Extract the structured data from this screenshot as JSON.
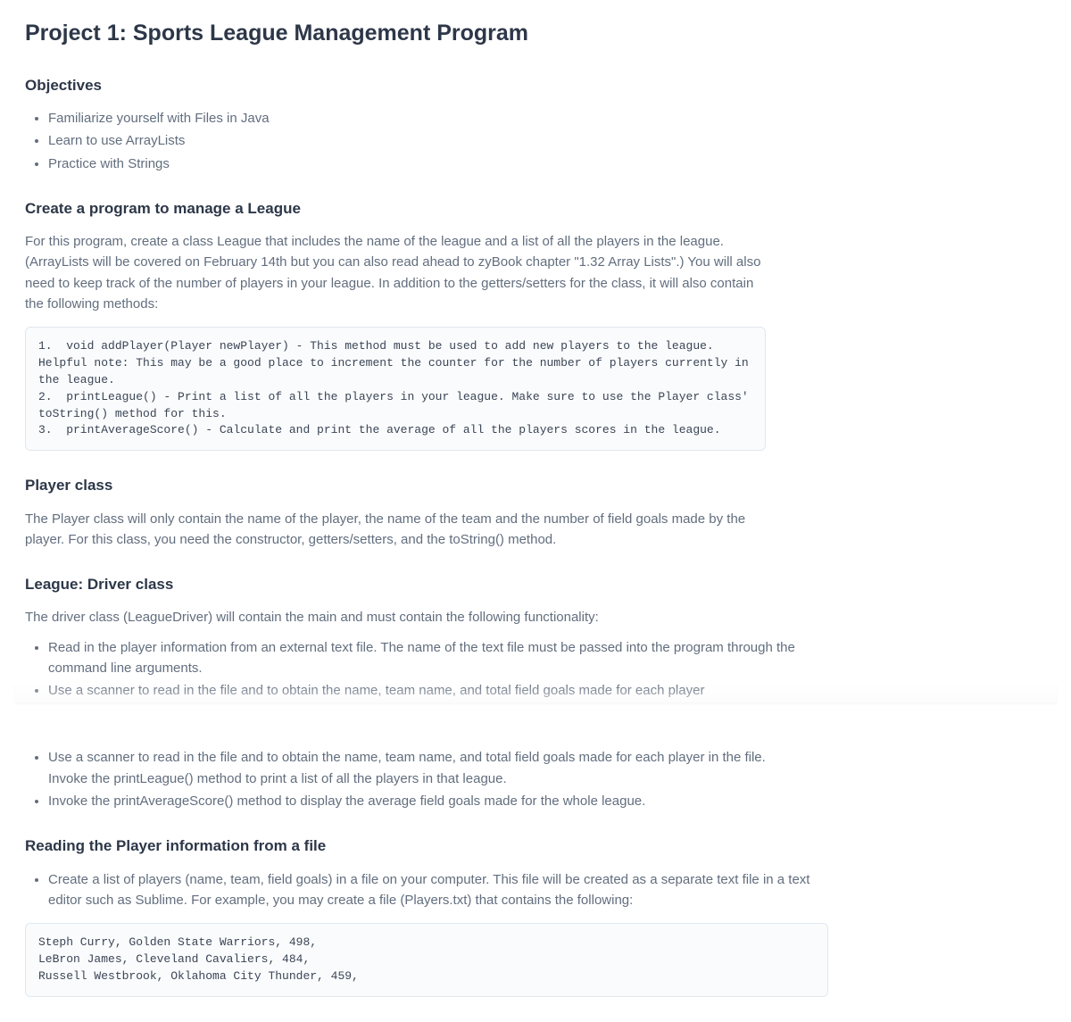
{
  "title": "Project 1: Sports League Management Program",
  "objectives": {
    "heading": "Objectives",
    "items": [
      "Familiarize yourself with Files in Java",
      "Learn to use ArrayLists",
      "Practice with Strings"
    ]
  },
  "create": {
    "heading": "Create a program to manage a League",
    "paragraph": "For this program, create a class League that includes the name of the league and a list of all the players in the league.  (ArrayLists will be covered on February 14th but you can also read ahead to zyBook chapter \"1.32 Array Lists\".)  You will also need to keep track of the number of players in your league. In addition to the getters/setters for the class, it will also contain the following methods:",
    "code": "1.  void addPlayer(Player newPlayer) - This method must be used to add new players to the league. Helpful note: This may be a good place to increment the counter for the number of players currently in the league.\n2.  printLeague() - Print a list of all the players in your league. Make sure to use the Player class' toString() method for this.\n3.  printAverageScore() - Calculate and print the average of all the players scores in the league."
  },
  "player": {
    "heading": "Player class",
    "paragraph": "The Player class will only contain the name of the player, the name of the team and the number of field goals made by the player. For this class, you need the constructor, getters/setters, and the toString() method."
  },
  "driver": {
    "heading": "League: Driver class",
    "paragraph": "The driver class (LeagueDriver) will contain the main and must contain the following functionality:",
    "items1": [
      "Read in the player information from an external text file. The name of the text file must be passed into the program through the command line arguments.",
      "Use a scanner to read in the file and to obtain the name, team name, and total field goals made for each player"
    ],
    "items2a": "Use a scanner to read in the file and to obtain the name, team name, and total field goals made for each player in the file.",
    "items2a_extra": "Invoke the printLeague() method to print a list of all the players in that league.",
    "items2b": "Invoke the printAverageScore() method to display the average field goals made for the whole league."
  },
  "reading": {
    "heading": "Reading the Player information from a file",
    "item": "Create a list of players (name, team, field goals) in a file on your computer. This file will be created as a separate text file in a text editor such as Sublime. For example, you may create a file (Players.txt) that contains the following:",
    "code": "Steph Curry, Golden State Warriors, 498,\nLeBron James, Cleveland Cavaliers, 484,\nRussell Westbrook, Oklahoma City Thunder, 459,"
  }
}
